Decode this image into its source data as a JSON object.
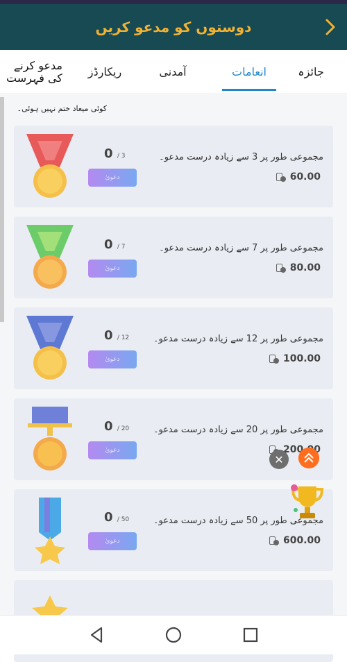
{
  "header": {
    "title": "دوستوں کو مدعو کریں"
  },
  "tabs": [
    {
      "label": "جائزہ"
    },
    {
      "label": "انعامات",
      "active": true
    },
    {
      "label": "آمدنی"
    },
    {
      "label": "ریکارڈز"
    },
    {
      "label": "مدعو کرنے کی فہرست"
    }
  ],
  "notice": "کوئی میعاد ختم نہیں ہوئی۔",
  "cards": [
    {
      "desc": "مجموعی طور پر 3 سے زیادہ درست مدعو۔",
      "reward": "60.00",
      "progress": "0",
      "target": "/ 3",
      "claim": "دعویٰ",
      "medal_color": "#e85a5a"
    },
    {
      "desc": "مجموعی طور پر 7 سے زیادہ درست مدعو۔",
      "reward": "80.00",
      "progress": "0",
      "target": "/ 7",
      "claim": "دعویٰ",
      "medal_color": "#6ccc6a"
    },
    {
      "desc": "مجموعی طور پر 12 سے زیادہ درست مدعو۔",
      "reward": "100.00",
      "progress": "0",
      "target": "/ 12",
      "claim": "دعویٰ",
      "medal_color": "#5d79d4"
    },
    {
      "desc": "مجموعی طور پر 20 سے زیادہ درست مدعو۔",
      "reward": "200.00",
      "progress": "0",
      "target": "/ 20",
      "claim": "دعویٰ",
      "medal_color": "#6f80d8"
    },
    {
      "desc": "مجموعی طور پر 50 سے زیادہ درست مدعو۔",
      "reward": "600.00",
      "progress": "0",
      "target": "/ 50",
      "claim": "دعویٰ",
      "medal_color": "#4ca9e8"
    }
  ],
  "floating": {
    "close_symbol": "✕"
  },
  "colors": {
    "header_bg": "#174a52",
    "title": "#f2b233",
    "accent": "#1e88c9"
  },
  "icons": [
    "back-chevron-icon",
    "coin-icon",
    "close-icon",
    "scroll-up-icon",
    "trophy-icon",
    "nav-back-icon",
    "nav-home-icon",
    "nav-recents-icon"
  ]
}
